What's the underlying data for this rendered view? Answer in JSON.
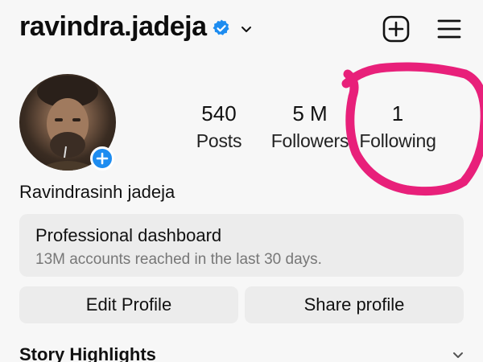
{
  "header": {
    "username": "ravindra.jadeja",
    "verified_icon": "verified-badge-icon",
    "dropdown_icon": "chevron-down-icon",
    "new_post_icon": "plus-square-icon",
    "menu_icon": "hamburger-menu-icon"
  },
  "profile": {
    "add_story_icon": "plus-icon",
    "full_name": "Ravindrasinh jadeja"
  },
  "stats": {
    "posts": {
      "value": "540",
      "label": "Posts"
    },
    "followers": {
      "value": "5 M",
      "label": "Followers"
    },
    "following": {
      "value": "1",
      "label": "Following"
    }
  },
  "dashboard": {
    "title": "Professional dashboard",
    "subtitle": "13M accounts reached in the last 30 days."
  },
  "actions": {
    "edit_profile": "Edit Profile",
    "share_profile": "Share profile"
  },
  "highlights": {
    "label": "Story Highlights",
    "chevron_icon": "chevron-down-icon"
  },
  "colors": {
    "verified": "#1d8cf0",
    "annotation": "#e8207a",
    "card_bg": "#ececec",
    "subtle_text": "#777777"
  }
}
